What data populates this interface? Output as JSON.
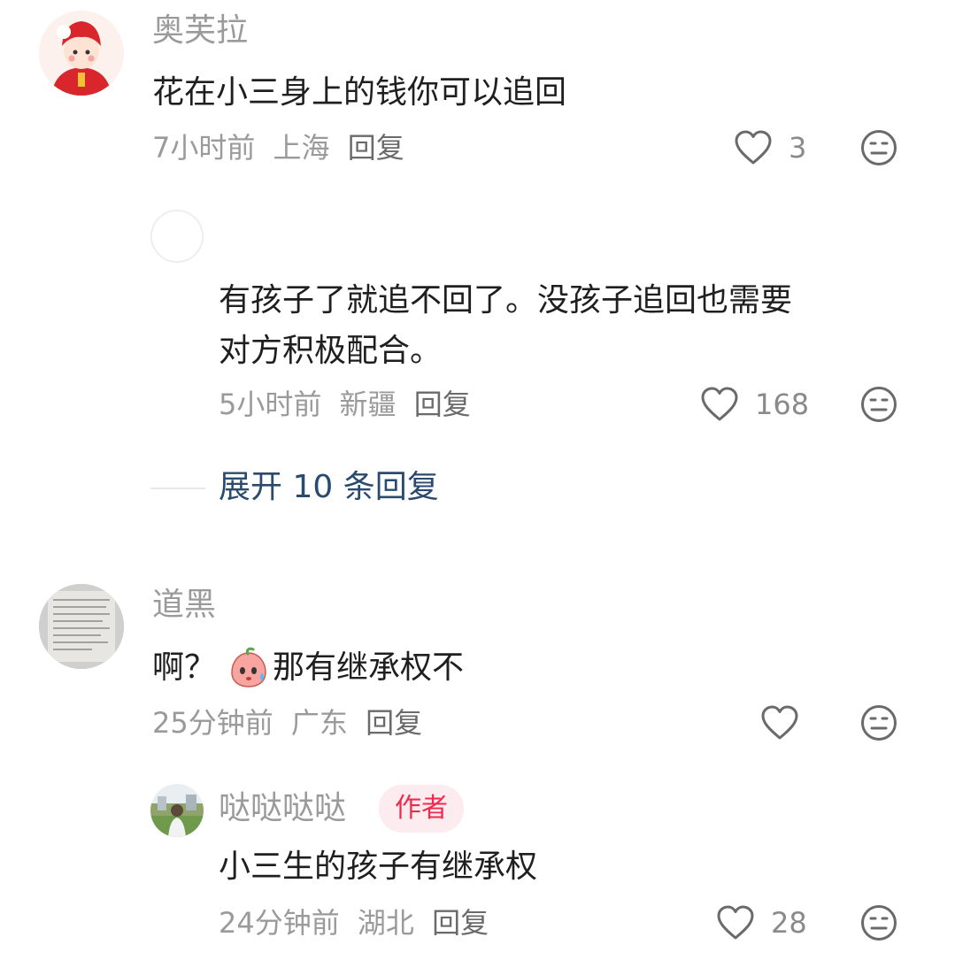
{
  "comments": [
    {
      "user": "奥芙拉",
      "text": "花在小三身上的钱你可以追回",
      "time": "7小时前",
      "location": "上海",
      "reply_label": "回复",
      "likes": "3",
      "replies": [
        {
          "user": "",
          "text_lines": [
            "有孩子了就追不回了。没孩子追回也需要",
            "对方积极配合。"
          ],
          "time": "5小时前",
          "location": "新疆",
          "reply_label": "回复",
          "likes": "168"
        }
      ],
      "expand_label": "展开 10 条回复"
    },
    {
      "user": "道黑",
      "text_prefix": "啊？",
      "emoji": "sweating-peach-emoji",
      "text_suffix": "那有继承权不",
      "time": "25分钟前",
      "location": "广东",
      "reply_label": "回复",
      "likes": "",
      "replies": [
        {
          "user": "哒哒哒哒",
          "badge": "作者",
          "text": "小三生的孩子有继承权",
          "time": "24分钟前",
          "location": "湖北",
          "reply_label": "回复",
          "likes": "28"
        }
      ]
    }
  ],
  "colors": {
    "username": "#9a9a9a",
    "body_text": "#1f1f1f",
    "expand_link": "#2a4a6e",
    "author_badge_bg": "#fdecef",
    "author_badge_text": "#ee2b4d"
  },
  "icons": {
    "like": "heart-outline-icon",
    "dislike": "neutral-face-icon"
  }
}
